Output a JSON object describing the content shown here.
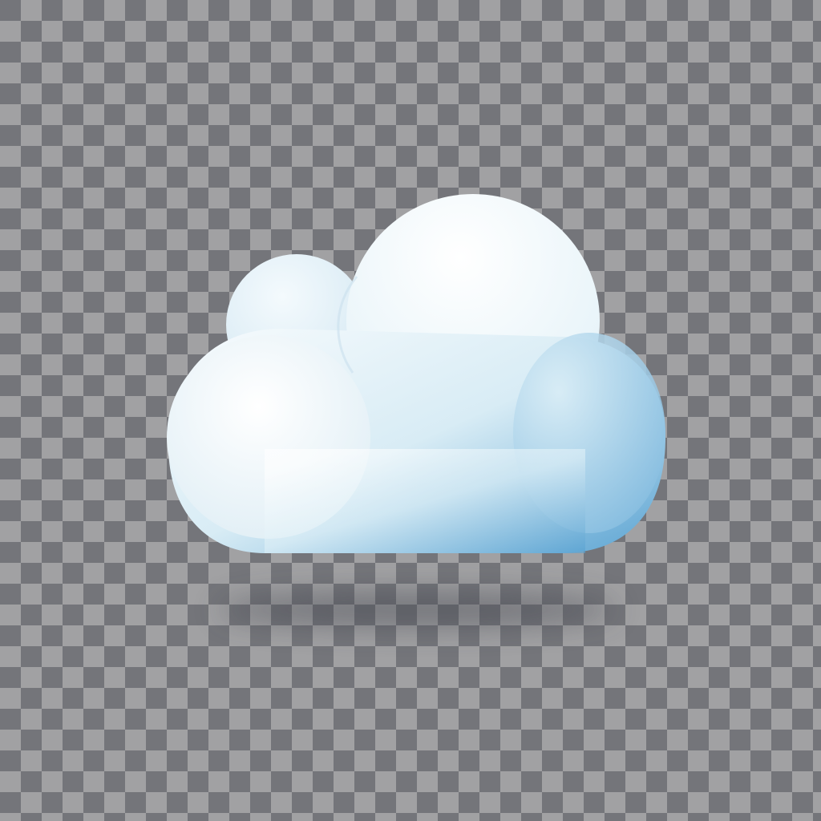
{
  "image": {
    "subject": "cloud-icon",
    "background": "transparency-checkerboard"
  },
  "colors": {
    "checker_dark": "#6f7073",
    "checker_light": "#a1a1a3",
    "cloud_top": "#ffffff",
    "cloud_mid": "#dff0f7",
    "cloud_bottom": "#5aa3d2",
    "shadow": "#3d4048"
  }
}
